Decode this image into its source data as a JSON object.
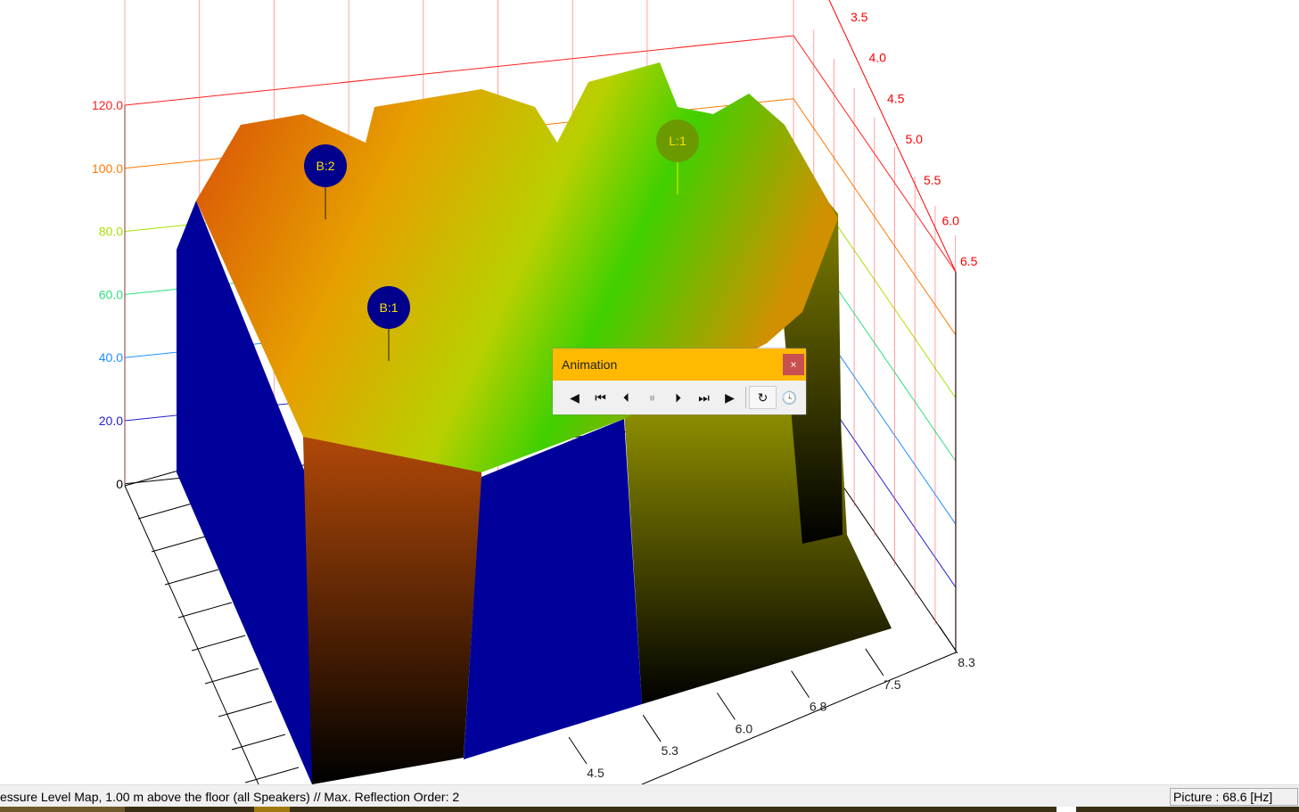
{
  "chart_data": {
    "type": "3d-surface",
    "z_ticks": [
      "120.0",
      "100.0",
      "80.0",
      "60.0",
      "40.0",
      "20.0",
      "0"
    ],
    "y_ticks": [
      "3.5",
      "4.0",
      "4.5",
      "5.0",
      "5.5",
      "6.0",
      "6.5"
    ],
    "x_ticks": [
      "4.5",
      "5.3",
      "6.0",
      "6.8",
      "7.5",
      "8.3"
    ],
    "zlim": [
      0,
      120
    ],
    "markers": [
      {
        "label": "B:2"
      },
      {
        "label": "B:1"
      },
      {
        "label": "L:1"
      }
    ]
  },
  "animation": {
    "title": "Animation",
    "close": "×",
    "buttons": [
      {
        "name": "prev",
        "glyph": "◀"
      },
      {
        "name": "first",
        "glyph": "⏮"
      },
      {
        "name": "step-back",
        "glyph": "⏴"
      },
      {
        "name": "pause",
        "glyph": "⏸"
      },
      {
        "name": "step-forward",
        "glyph": "⏵"
      },
      {
        "name": "last",
        "glyph": "⏭"
      },
      {
        "name": "play",
        "glyph": "▶"
      }
    ],
    "loop": "↻",
    "timer": "🕓"
  },
  "status": {
    "message": "essure Level Map, 1.00 m above the floor (all Speakers) // Max. Reflection Order: 2",
    "picture": "Picture : 68.6 [Hz]"
  }
}
